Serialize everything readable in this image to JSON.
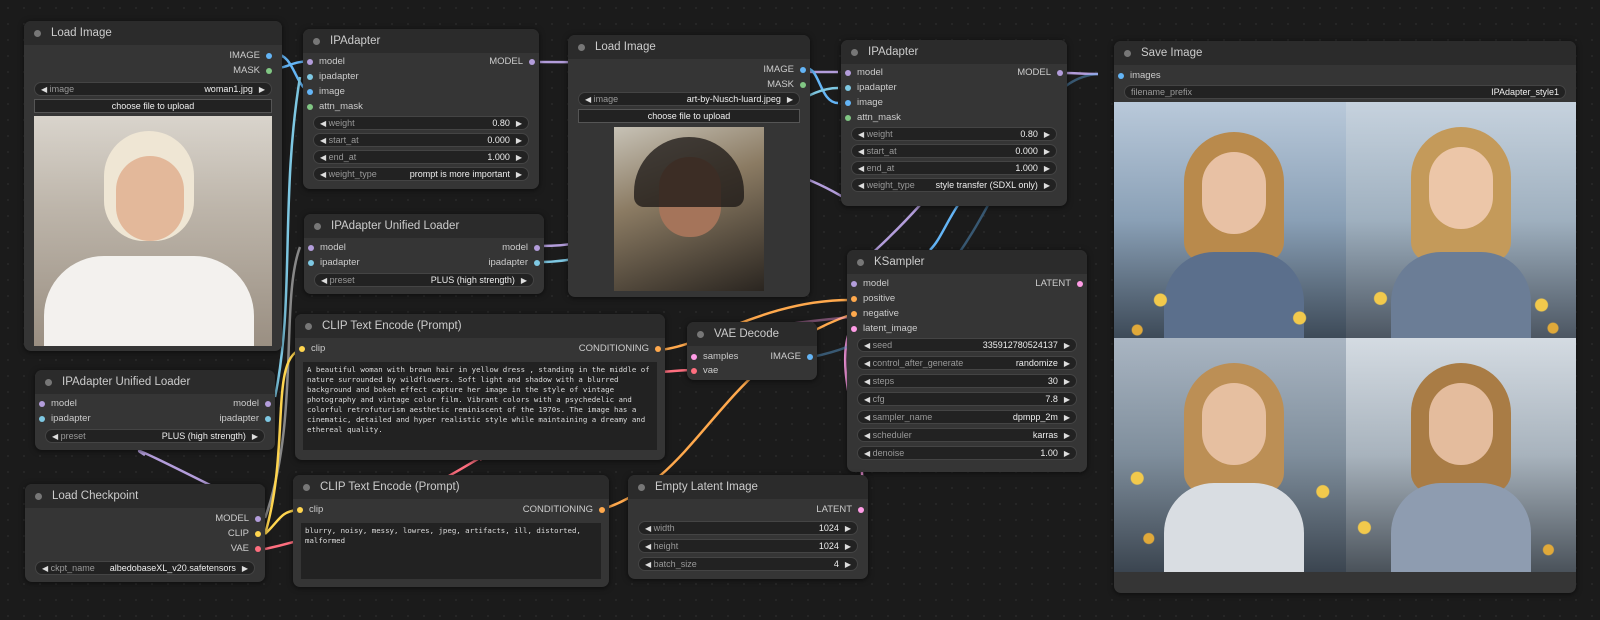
{
  "load_image_1": {
    "title": "Load Image",
    "out_image": "IMAGE",
    "out_mask": "MASK",
    "w_label": "image",
    "w_value": "woman1.jpg",
    "upload": "choose file to upload"
  },
  "ipadapter_1": {
    "title": "IPAdapter",
    "in_model": "model",
    "in_ipadapter": "ipadapter",
    "in_image": "image",
    "in_attn": "attn_mask",
    "out_model": "MODEL",
    "weight_lbl": "weight",
    "weight_val": "0.80",
    "start_lbl": "start_at",
    "start_val": "0.000",
    "end_lbl": "end_at",
    "end_val": "1.000",
    "wt_lbl": "weight_type",
    "wt_val": "prompt is more important"
  },
  "load_image_2": {
    "title": "Load Image",
    "out_image": "IMAGE",
    "out_mask": "MASK",
    "w_label": "image",
    "w_value": "art-by-Nusch-luard.jpeg",
    "upload": "choose file to upload"
  },
  "ipadapter_2": {
    "title": "IPAdapter",
    "in_model": "model",
    "in_ipadapter": "ipadapter",
    "in_image": "image",
    "in_attn": "attn_mask",
    "out_model": "MODEL",
    "weight_lbl": "weight",
    "weight_val": "0.80",
    "start_lbl": "start_at",
    "start_val": "0.000",
    "end_lbl": "end_at",
    "end_val": "1.000",
    "wt_lbl": "weight_type",
    "wt_val": "style transfer (SDXL only)"
  },
  "save_image": {
    "title": "Save Image",
    "in_images": "images",
    "prefix_lbl": "filename_prefix",
    "prefix_val": "IPAdapter_style1"
  },
  "unified_1": {
    "title": "IPAdapter Unified Loader",
    "in_model": "model",
    "in_ipadapter": "ipadapter",
    "out_model": "model",
    "out_ipadapter": "ipadapter",
    "preset_lbl": "preset",
    "preset_val": "PLUS (high strength)"
  },
  "unified_2": {
    "title": "IPAdapter Unified Loader",
    "in_model": "model",
    "in_ipadapter": "ipadapter",
    "out_model": "model",
    "out_ipadapter": "ipadapter",
    "preset_lbl": "preset",
    "preset_val": "PLUS (high strength)"
  },
  "ksampler": {
    "title": "KSampler",
    "in_model": "model",
    "in_positive": "positive",
    "in_negative": "negative",
    "in_latent": "latent_image",
    "out_latent": "LATENT",
    "widgets": [
      {
        "l": "seed",
        "v": "335912780524137"
      },
      {
        "l": "control_after_generate",
        "v": "randomize"
      },
      {
        "l": "steps",
        "v": "30"
      },
      {
        "l": "cfg",
        "v": "7.8"
      },
      {
        "l": "sampler_name",
        "v": "dpmpp_2m"
      },
      {
        "l": "scheduler",
        "v": "karras"
      },
      {
        "l": "denoise",
        "v": "1.00"
      }
    ]
  },
  "clip_pos": {
    "title": "CLIP Text Encode (Prompt)",
    "in_clip": "clip",
    "out_cond": "CONDITIONING",
    "text": "A beautiful woman with brown hair in yellow dress , standing in the middle of nature surrounded by wildflowers. Soft light and shadow with a blurred background and bokeh effect capture her image in the style of vintage photography and vintage color film. Vibrant colors with a psychedelic and colorful retrofuturism aesthetic reminiscent of the 1970s. The image has a cinematic, detailed and hyper realistic style while maintaining a dreamy and ethereal quality."
  },
  "vae_decode": {
    "title": "VAE Decode",
    "in_samples": "samples",
    "in_vae": "vae",
    "out_image": "IMAGE"
  },
  "load_ckpt": {
    "title": "Load Checkpoint",
    "out_model": "MODEL",
    "out_clip": "CLIP",
    "out_vae": "VAE",
    "ckpt_lbl": "ckpt_name",
    "ckpt_val": "albedobaseXL_v20.safetensors"
  },
  "clip_neg": {
    "title": "CLIP Text Encode (Prompt)",
    "in_clip": "clip",
    "out_cond": "CONDITIONING",
    "text": "blurry, noisy, messy, lowres, jpeg, artifacts, ill, distorted, malformed"
  },
  "empty_latent": {
    "title": "Empty Latent Image",
    "out_latent": "LATENT",
    "width_lbl": "width",
    "width_val": "1024",
    "height_lbl": "height",
    "height_val": "1024",
    "batch_lbl": "batch_size",
    "batch_val": "4"
  },
  "colors": {
    "model": "#b39ddb",
    "ipadapter": "#7ec8e3",
    "image": "#64b5f6",
    "mask": "#81c784",
    "clip": "#ffd54f",
    "vae": "#ff6f7f",
    "conditioning": "#ffa94d",
    "latent": "#ff9ce6",
    "canvas": "#1b1b1b",
    "node": "#353535"
  }
}
